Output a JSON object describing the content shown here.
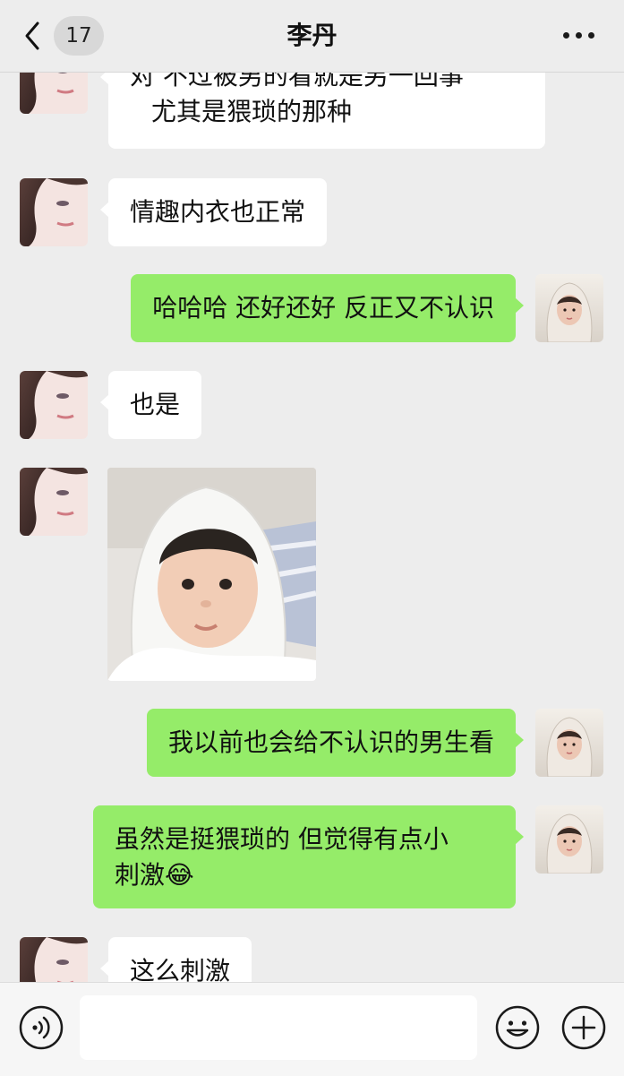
{
  "header": {
    "unread_count": "17",
    "title": "李丹",
    "icons": {
      "back": "chevron-left-icon",
      "more": "more-dots-icon"
    }
  },
  "messages": [
    {
      "sender": "contact",
      "type": "text",
      "lines": [
        "对  不过被男的看就是另一回事",
        "尤其是猥琐的那种"
      ]
    },
    {
      "sender": "contact",
      "type": "text",
      "lines": [
        "情趣内衣也正常"
      ]
    },
    {
      "sender": "me",
      "type": "text",
      "lines": [
        "哈哈哈 还好还好 反正又不认识"
      ]
    },
    {
      "sender": "contact",
      "type": "text",
      "lines": [
        "也是"
      ]
    },
    {
      "sender": "contact",
      "type": "sticker",
      "description": "baby-in-white-hood-sticker"
    },
    {
      "sender": "me",
      "type": "text",
      "lines": [
        "我以前也会给不认识的男生看"
      ]
    },
    {
      "sender": "me",
      "type": "text",
      "lines": [
        "虽然是挺猥琐的 但觉得有点小",
        "刺激"
      ],
      "emoji": "😂"
    },
    {
      "sender": "contact",
      "type": "text",
      "lines": [
        "这么刺激"
      ]
    }
  ],
  "input_bar": {
    "value": "",
    "icons": {
      "voice": "voice-icon",
      "emoji": "emoji-icon",
      "plus": "plus-icon"
    }
  },
  "colors": {
    "background": "#ededed",
    "incoming_bubble": "#ffffff",
    "outgoing_bubble": "#95ec69",
    "header_badge": "#d8d8d8"
  }
}
